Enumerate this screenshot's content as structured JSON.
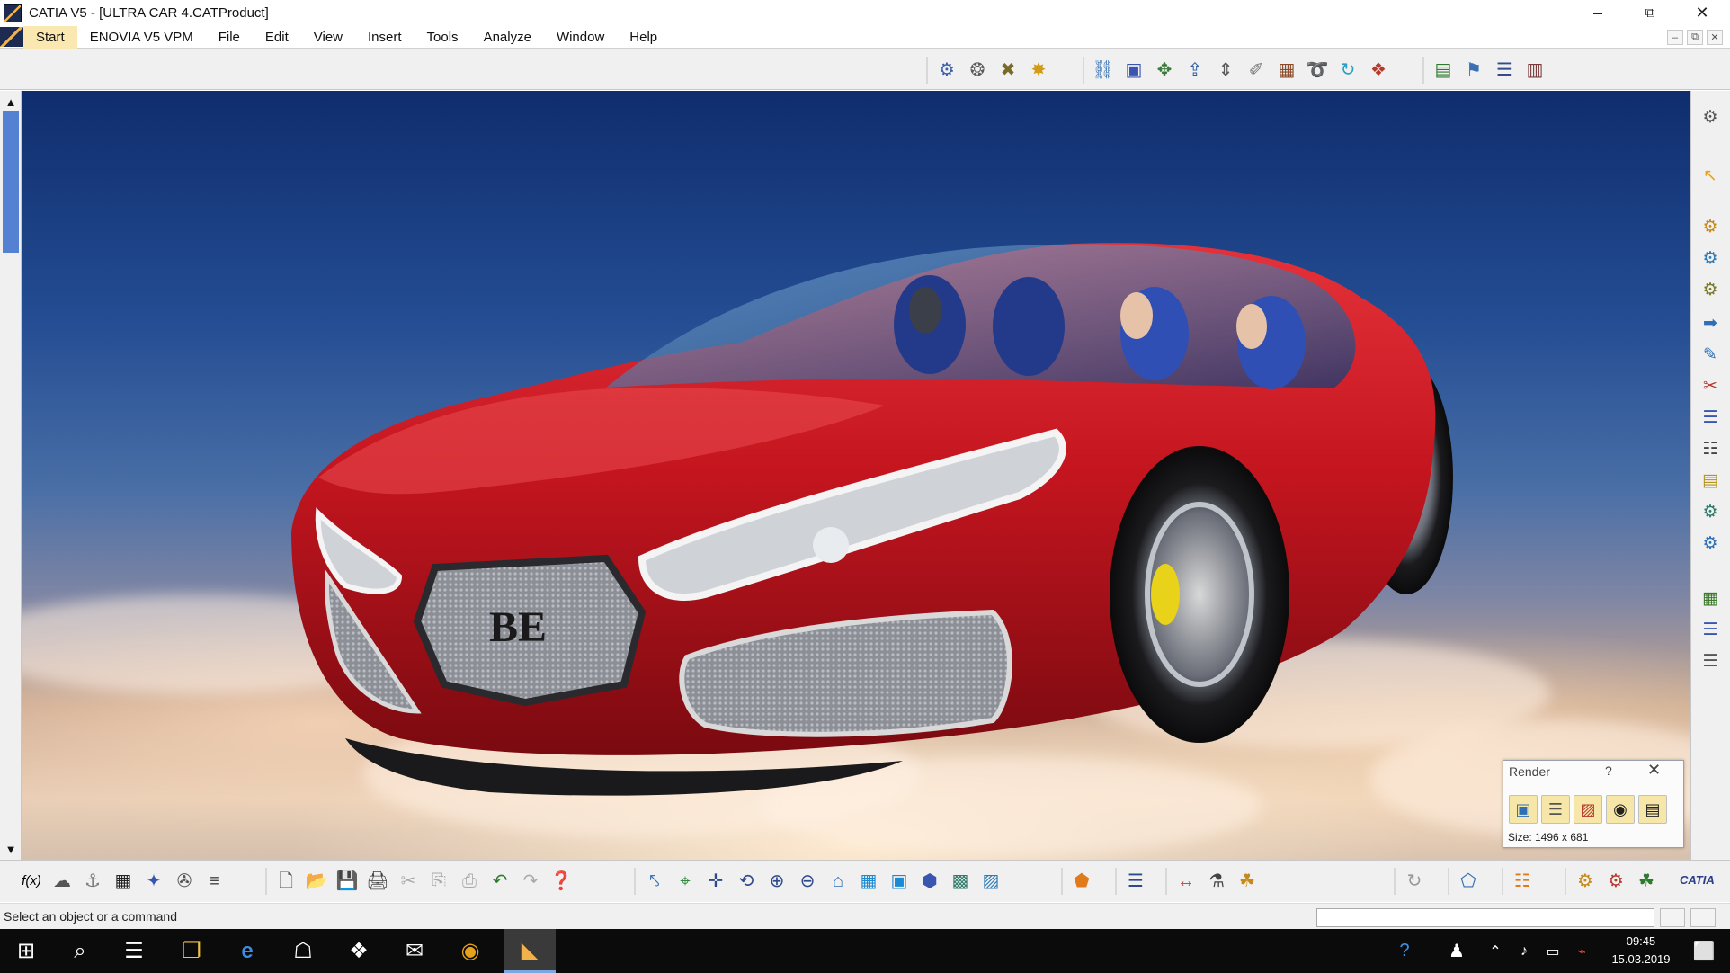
{
  "window": {
    "title": "CATIA V5 - [ULTRA CAR 4.CATProduct]",
    "minimize": "–",
    "restore": "⧉",
    "close": "✕"
  },
  "menu": {
    "items": [
      "Start",
      "ENOVIA V5 VPM",
      "File",
      "Edit",
      "View",
      "Insert",
      "Tools",
      "Analyze",
      "Window",
      "Help"
    ],
    "mdi_minimize": "–",
    "mdi_restore": "⧉",
    "mdi_close": "✕"
  },
  "top_toolbar": {
    "group1": [
      "⚙",
      "❂",
      "✖",
      "✸"
    ],
    "group2": [
      "⛓",
      "▣",
      "✥",
      "⇪",
      "⇕",
      "✐",
      "▦",
      "➰",
      "↻",
      "❖"
    ],
    "group3": [
      "▤",
      "⚑",
      "☰",
      "▥"
    ]
  },
  "scroll": {
    "up": "▲",
    "down": "▼"
  },
  "right_toolbar": [
    "⚙",
    "↖",
    "⚙",
    "⚙",
    "⚙",
    "➡",
    "✎",
    "✂",
    "☰",
    "☷",
    "▤",
    "⚙",
    "⚙",
    "▦",
    "☰",
    "☰"
  ],
  "render_panel": {
    "title": "Render",
    "help": "?",
    "close": "✕",
    "icons": [
      "▣",
      "☰",
      "▨",
      "◉",
      "▤"
    ],
    "size_text": "Size: 1496 x 681"
  },
  "viewport": {
    "emblem_text": "BE"
  },
  "bottom_toolbar": {
    "group1": [
      "f(x)",
      "☁",
      "⚓",
      "▦",
      "✦",
      "✇",
      "≡"
    ],
    "group2": [
      "🗋",
      "📂",
      "💾",
      "🖨",
      "✂",
      "⎘",
      "⎙",
      "↶",
      "↷",
      "❓"
    ],
    "group3": [
      "⤣",
      "⌖",
      "✛",
      "⟲",
      "⊕",
      "⊖",
      "⌂",
      "▦",
      "▣",
      "⬢",
      "▩",
      "▨"
    ],
    "group4": [
      "⬟"
    ],
    "group5": [
      "☰"
    ],
    "group6": [
      "↔",
      "⚗",
      "☘"
    ],
    "group7": [
      "↻"
    ],
    "group8": [
      "⬠"
    ],
    "group9": [
      "☷"
    ],
    "group10": [
      "⚙",
      "⚙",
      "☘"
    ],
    "logo": "CATIA"
  },
  "status": {
    "message": "Select an object or a command"
  },
  "taskbar": {
    "icons": [
      "⊞",
      "⌕",
      "☰",
      "❐",
      "e",
      "☖",
      "❖",
      "✉",
      "◉",
      "◣"
    ],
    "tray": [
      "?",
      "♟",
      "⌃",
      "♪",
      "▭",
      "⌁"
    ],
    "time": "09:45",
    "date": "15.03.2019",
    "notify": "⬜"
  },
  "colors": {
    "car_red": "#c4151f",
    "sky_top": "#0f2d6e",
    "accent_start": "#fbe8b0",
    "status_bg": "#f0f0f0"
  }
}
